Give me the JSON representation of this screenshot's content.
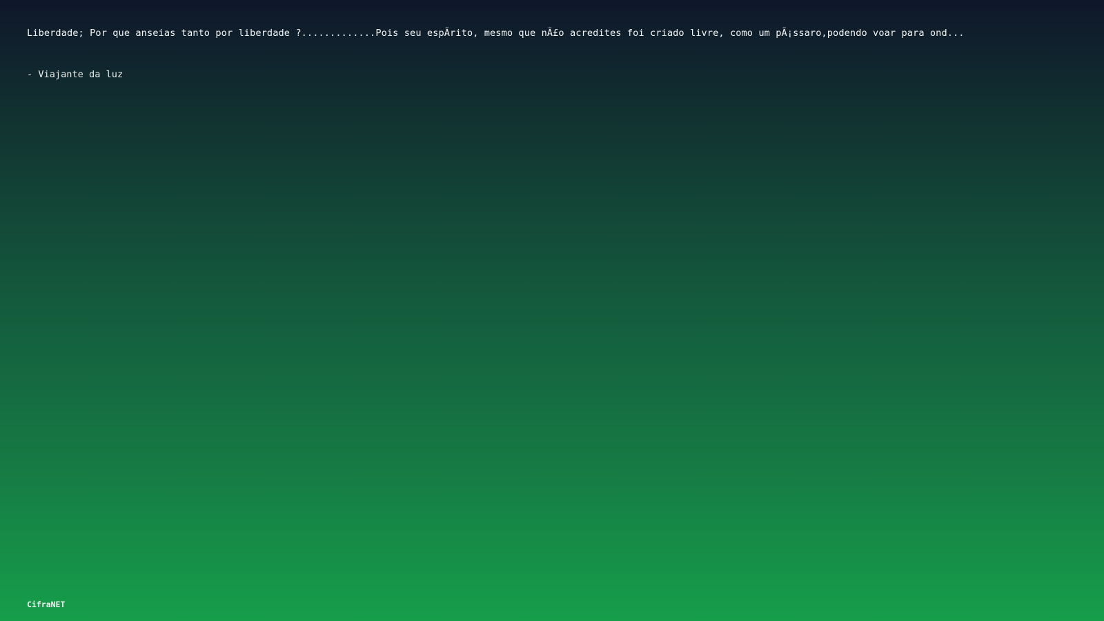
{
  "quote": {
    "text": "Liberdade; Por que anseias tanto por liberdade ?.............Pois seu espÃ­rito, mesmo que nÃ£o acredites foi criado livre, como um pÃ¡ssaro,podendo voar para ond...",
    "author": "- Viajante da luz"
  },
  "footer": {
    "brand": "CifraNET"
  },
  "colors": {
    "background_top": "#0f172a",
    "background_bottom": "#169e4a",
    "text": "#f1f5f4"
  }
}
